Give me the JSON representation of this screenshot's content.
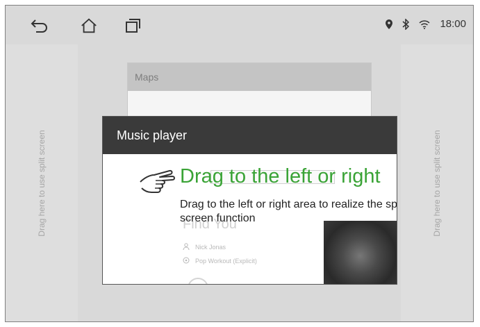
{
  "status": {
    "time": "18:00"
  },
  "split_zones": {
    "left_label": "Drag here to use split screen",
    "right_label": "Drag here to use split screen"
  },
  "maps_card": {
    "title": "Maps"
  },
  "music_card": {
    "title": "Music player",
    "song_title": "Find You",
    "artist": "Nick Jonas",
    "album": "Pop Workout (Explicit)"
  },
  "hint": {
    "title": "Drag to the left or right",
    "description": "Drag to the left or right area to realize the split screen function"
  },
  "colors": {
    "hint_green": "#3aa336",
    "header_dark": "#3a3a3a"
  },
  "icons": [
    "back-icon",
    "home-icon",
    "recent-apps-icon",
    "location-icon",
    "bluetooth-icon",
    "wifi-icon",
    "hand-pointer-icon"
  ]
}
